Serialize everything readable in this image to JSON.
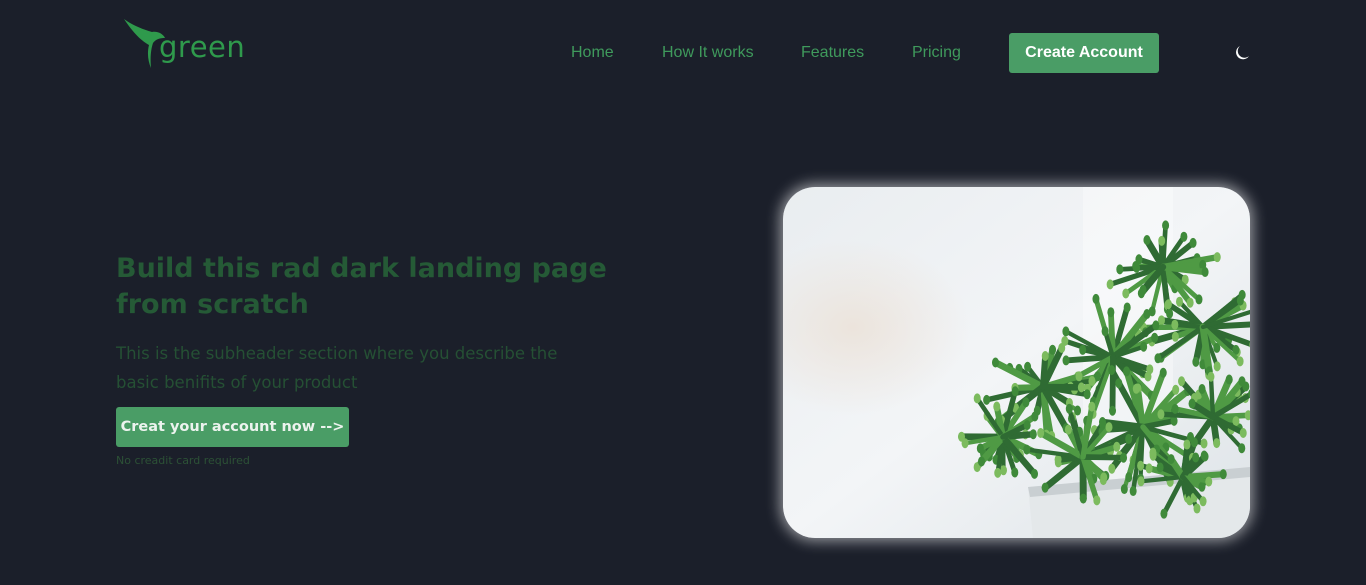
{
  "header": {
    "logo_text": "green",
    "nav": [
      {
        "label": "Home"
      },
      {
        "label": "How It works"
      },
      {
        "label": "Features"
      },
      {
        "label": "Pricing"
      }
    ],
    "cta_label": "Create Account",
    "theme_icon": "moon-icon"
  },
  "hero": {
    "title": "Build this rad dark landing page from scratch",
    "subtitle": "This is the subheader section where you describe the basic benifits of your product",
    "cta_label": "Creat your account now -->",
    "note": "No creadit card required",
    "image_icon": "succulent-plant-photo"
  },
  "colors": {
    "background": "#1b1f2a",
    "accent": "#4a9d66",
    "nav_text": "#3f9a5c",
    "heading": "#255a36"
  }
}
